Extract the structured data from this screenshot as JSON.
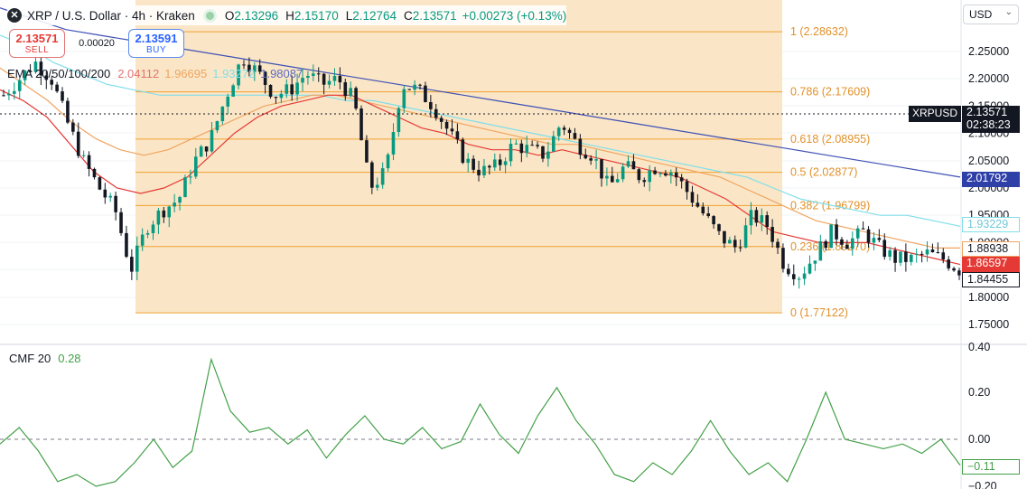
{
  "header": {
    "symbol_icon": "x-icon",
    "title": "XRP / U.S. Dollar · 4h · Kraken",
    "ohlc": [
      {
        "label": "O",
        "value": "2.13296"
      },
      {
        "label": "H",
        "value": "2.15170"
      },
      {
        "label": "L",
        "value": "2.12764"
      },
      {
        "label": "C",
        "value": "2.13571"
      }
    ],
    "change": "+0.00273 (+0.13%)"
  },
  "trade": {
    "sell_price": "2.13571",
    "sell_label": "SELL",
    "spread": "0.00020",
    "buy_price": "2.13591",
    "buy_label": "BUY"
  },
  "ema_legend": {
    "label": "EMA 20/50/100/200",
    "values": [
      {
        "text": "2.04112",
        "color": "#e57373"
      },
      {
        "text": "1.96695",
        "color": "#f0a460"
      },
      {
        "text": "1.93272",
        "color": "#80deea"
      },
      {
        "text": "1.98087",
        "color": "#5c6bc0"
      }
    ]
  },
  "cmf_legend": {
    "label": "CMF 20",
    "value": "0.28"
  },
  "currency": {
    "label": "USD"
  },
  "price_tags": {
    "symbol": "XRPUSD",
    "last_price": "2.13571",
    "countdown": "02:38:23",
    "ema200": "2.01792",
    "ema100": "1.93229",
    "ema50": "1.88938",
    "ema20": "1.86597",
    "last_close": "1.84455",
    "cmf": "−0.11"
  },
  "colors": {
    "up": "#089981",
    "down": "#131722",
    "fib_fill": "#fae5c3",
    "fib_line": "#f0a030",
    "ema20": "#e53935",
    "ema50": "#f0a460",
    "ema100": "#80deea",
    "ema200": "#3f51b5",
    "cmf": "#43a047"
  },
  "chart_data": [
    {
      "type": "candlestick",
      "title": "XRP / U.S. Dollar · 4h · Kraken",
      "ylim": [
        1.72,
        2.32
      ],
      "y_ticks": [
        "2.25000",
        "2.20000",
        "2.15000",
        "2.10000",
        "2.05000",
        "2.00000",
        "1.95000",
        "1.90000",
        "1.85000",
        "1.80000",
        "1.75000"
      ],
      "fibonacci_levels": [
        {
          "label": "1 (2.28632)",
          "value": 2.28632
        },
        {
          "label": "0.786 (2.17609)",
          "value": 2.17609
        },
        {
          "label": "0.618 (2.08955)",
          "value": 2.08955
        },
        {
          "label": "0.5 (2.02877)",
          "value": 2.02877
        },
        {
          "label": "0.382 (1.96799)",
          "value": 1.96799
        },
        {
          "label": "0.236 (1.89270)",
          "value": 1.8927
        },
        {
          "label": "0 (1.77122)",
          "value": 1.77122
        }
      ],
      "price_anchors": [
        2.17,
        2.2,
        2.23,
        2.2,
        2.12,
        2.05,
        2.0,
        1.96,
        1.85,
        1.93,
        1.96,
        1.98,
        2.05,
        2.09,
        2.17,
        2.24,
        2.21,
        2.17,
        2.18,
        2.21,
        2.19,
        2.2,
        2.16,
        2.0,
        2.03,
        2.19,
        2.18,
        2.15,
        2.1,
        2.05,
        2.03,
        2.04,
        2.08,
        2.07,
        2.06,
        2.12,
        2.08,
        2.06,
        2.0,
        2.04,
        2.02,
        2.04,
        2.03,
        1.99,
        1.95,
        1.91,
        1.89,
        1.95,
        1.93,
        1.86,
        1.84,
        1.88,
        1.92,
        1.9,
        1.92,
        1.89,
        1.87,
        1.87,
        1.88,
        1.87,
        1.85
      ],
      "ema20": [
        2.18,
        2.16,
        2.13,
        2.08,
        2.03,
        2.0,
        1.99,
        2.0,
        2.02,
        2.06,
        2.1,
        2.13,
        2.15,
        2.16,
        2.17,
        2.17,
        2.15,
        2.13,
        2.11,
        2.1,
        2.08,
        2.07,
        2.07,
        2.06,
        2.07,
        2.06,
        2.05,
        2.04,
        2.03,
        2.02,
        2.0,
        1.98,
        1.95,
        1.92,
        1.91,
        1.9,
        1.9,
        1.9,
        1.89,
        1.88,
        1.87,
        1.86
      ],
      "ema50": [
        2.22,
        2.19,
        2.16,
        2.12,
        2.09,
        2.07,
        2.06,
        2.07,
        2.09,
        2.11,
        2.13,
        2.15,
        2.16,
        2.17,
        2.17,
        2.16,
        2.15,
        2.14,
        2.13,
        2.12,
        2.11,
        2.1,
        2.09,
        2.08,
        2.08,
        2.07,
        2.06,
        2.05,
        2.04,
        2.03,
        2.02,
        2.0,
        1.98,
        1.96,
        1.94,
        1.93,
        1.92,
        1.91,
        1.9,
        1.89,
        1.89
      ],
      "ema100": [
        2.28,
        2.26,
        2.23,
        2.21,
        2.19,
        2.18,
        2.17,
        2.17,
        2.17,
        2.17,
        2.17,
        2.17,
        2.17,
        2.16,
        2.16,
        2.15,
        2.14,
        2.13,
        2.12,
        2.11,
        2.1,
        2.09,
        2.08,
        2.07,
        2.06,
        2.05,
        2.04,
        2.03,
        2.02,
        2.0,
        1.98,
        1.97,
        1.96,
        1.95,
        1.95,
        1.94,
        1.93
      ],
      "ema200": [
        2.33,
        2.31,
        2.29,
        2.28,
        2.27,
        2.26,
        2.25,
        2.24,
        2.23,
        2.22,
        2.21,
        2.2,
        2.19,
        2.18,
        2.17,
        2.16,
        2.15,
        2.14,
        2.13,
        2.12,
        2.11,
        2.1,
        2.09,
        2.08,
        2.07,
        2.06,
        2.05,
        2.04,
        2.03,
        2.02
      ]
    },
    {
      "type": "line",
      "title": "CMF 20",
      "ylim": [
        -0.2,
        0.4
      ],
      "y_ticks": [
        "0.40",
        "0.20",
        "0.00",
        "−0.20"
      ],
      "values": [
        -0.02,
        0.05,
        -0.05,
        -0.18,
        -0.15,
        -0.2,
        -0.18,
        -0.1,
        0.0,
        -0.12,
        -0.05,
        0.34,
        0.12,
        0.03,
        0.05,
        -0.02,
        0.04,
        -0.08,
        0.02,
        0.1,
        0.0,
        -0.02,
        0.05,
        -0.04,
        -0.01,
        0.15,
        0.02,
        -0.06,
        0.1,
        0.22,
        0.08,
        -0.02,
        -0.15,
        -0.18,
        -0.1,
        -0.15,
        -0.05,
        0.08,
        -0.05,
        -0.15,
        -0.1,
        -0.18,
        0.0,
        0.2,
        0.0,
        -0.02,
        -0.04,
        -0.02,
        -0.06,
        0.0,
        -0.11
      ]
    }
  ]
}
